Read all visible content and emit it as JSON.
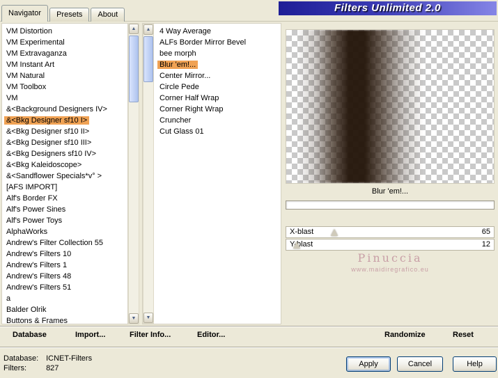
{
  "window": {
    "title": "Filters Unlimited 2.0"
  },
  "tabs": [
    {
      "label": "Navigator",
      "active": true
    },
    {
      "label": "Presets",
      "active": false
    },
    {
      "label": "About",
      "active": false
    }
  ],
  "icons": {
    "scroll_up": "▲",
    "scroll_down": "▼"
  },
  "navigator": {
    "categories": [
      {
        "label": "VM Distortion",
        "selected": false
      },
      {
        "label": "VM Experimental",
        "selected": false
      },
      {
        "label": "VM Extravaganza",
        "selected": false
      },
      {
        "label": "VM Instant Art",
        "selected": false
      },
      {
        "label": "VM Natural",
        "selected": false
      },
      {
        "label": "VM Toolbox",
        "selected": false
      },
      {
        "label": "VM",
        "selected": false
      },
      {
        "label": "&<Background Designers IV>",
        "selected": false
      },
      {
        "label": "&<Bkg Designer sf10 I>",
        "selected": true
      },
      {
        "label": "&<Bkg Designer sf10 II>",
        "selected": false
      },
      {
        "label": "&<Bkg Designer sf10 III>",
        "selected": false
      },
      {
        "label": "&<Bkg Designers sf10 IV>",
        "selected": false
      },
      {
        "label": "&<Bkg Kaleidoscope>",
        "selected": false
      },
      {
        "label": "&<Sandflower Specials*v° >",
        "selected": false
      },
      {
        "label": "[AFS IMPORT]",
        "selected": false
      },
      {
        "label": "Alf's Border FX",
        "selected": false
      },
      {
        "label": "Alf's Power Sines",
        "selected": false
      },
      {
        "label": "Alf's Power Toys",
        "selected": false
      },
      {
        "label": "AlphaWorks",
        "selected": false
      },
      {
        "label": "Andrew's Filter Collection 55",
        "selected": false
      },
      {
        "label": "Andrew's Filters 10",
        "selected": false
      },
      {
        "label": "Andrew's Filters 1",
        "selected": false
      },
      {
        "label": "Andrew's Filters 48",
        "selected": false
      },
      {
        "label": "Andrew's Filters 51",
        "selected": false
      },
      {
        "label": "a",
        "selected": false
      },
      {
        "label": "Balder Olrik",
        "selected": false
      },
      {
        "label": "Buttons & Frames",
        "selected": false
      }
    ],
    "filters": [
      {
        "label": "4 Way Average",
        "selected": false
      },
      {
        "label": "ALFs Border Mirror Bevel",
        "selected": false
      },
      {
        "label": "bee morph",
        "selected": false
      },
      {
        "label": "Blur 'em!...",
        "selected": true
      },
      {
        "label": "Center Mirror...",
        "selected": false
      },
      {
        "label": "Circle Pede",
        "selected": false
      },
      {
        "label": "Corner Half Wrap",
        "selected": false
      },
      {
        "label": "Corner Right Wrap",
        "selected": false
      },
      {
        "label": "Cruncher",
        "selected": false
      },
      {
        "label": "Cut Glass 01",
        "selected": false
      }
    ]
  },
  "preview": {
    "selected_filter": "Blur 'em!...",
    "params": [
      {
        "name": "X-blast",
        "value": 65,
        "thumb_pct": 23
      },
      {
        "name": "Y-blast",
        "value": 12,
        "thumb_pct": 5
      }
    ],
    "watermark": {
      "line1": "Pinuccia",
      "line2": "www.maidiregrafico.eu"
    }
  },
  "toolbar": {
    "database": "Database",
    "import": "Import...",
    "filter_info": "Filter Info...",
    "editor": "Editor...",
    "randomize": "Randomize",
    "reset": "Reset"
  },
  "statusbar": {
    "database_label": "Database:",
    "database_value": "ICNET-Filters",
    "filters_label": "Filters:",
    "filters_value": "827",
    "apply": "Apply",
    "cancel": "Cancel",
    "help": "Help"
  },
  "colors": {
    "dialog_bg": "#ECE9D8",
    "selection": "#F0A254",
    "title_gradient_left": "#1E1E96",
    "title_gradient_right": "#8585E6",
    "watermark": "#C89FA6",
    "streak_brown": "#2E1C0E"
  }
}
